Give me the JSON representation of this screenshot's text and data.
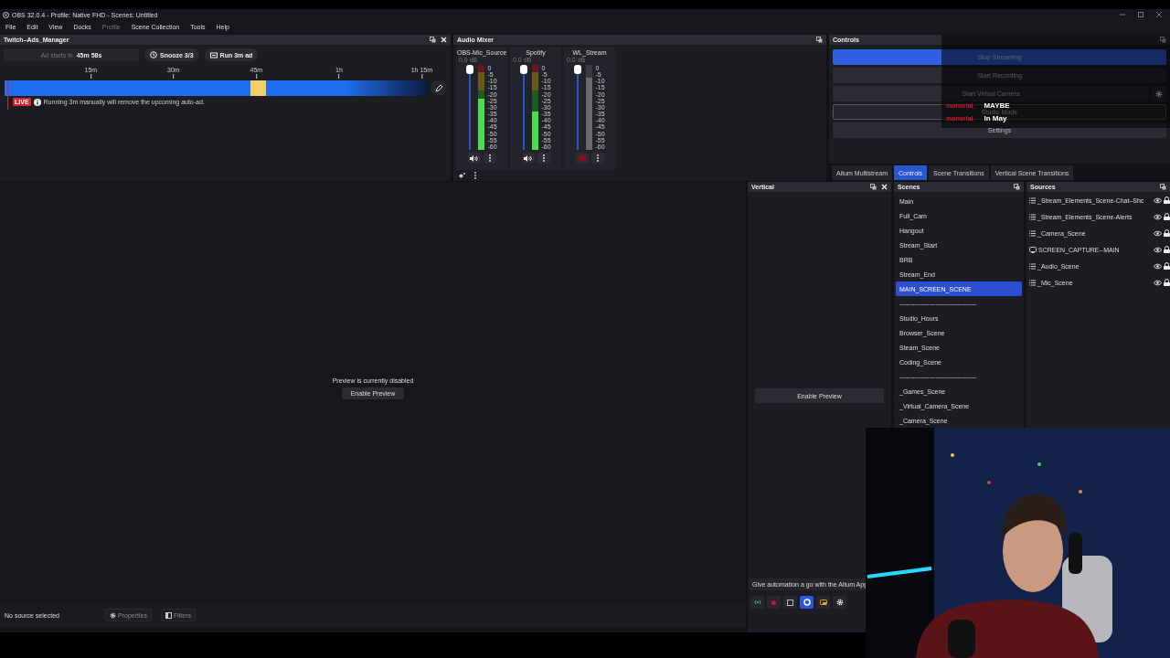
{
  "window": {
    "title": "OBS 32.0.4 - Profile: Native FHD - Scenes: Untitled"
  },
  "menu": [
    {
      "label": "File",
      "disabled": false
    },
    {
      "label": "Edit",
      "disabled": false
    },
    {
      "label": "View",
      "disabled": false
    },
    {
      "label": "Docks",
      "disabled": false
    },
    {
      "label": "Profile",
      "disabled": true
    },
    {
      "label": "Scene Collection",
      "disabled": false
    },
    {
      "label": "Tools",
      "disabled": false
    },
    {
      "label": "Help",
      "disabled": false
    }
  ],
  "ads_manager": {
    "title": "Twitch–Ads_Manager",
    "countdown_label": "Ad starts in",
    "countdown": "45m 58s",
    "snooze": "Snooze 3/3",
    "run_ad": "Run 3m ad",
    "ticks": [
      "15m",
      "30m",
      "45m",
      "1h",
      "1h 15m"
    ],
    "live_badge": "LIVE",
    "notice": "Running 3m manually will remove the upcoming auto-ad."
  },
  "audio_mixer": {
    "title": "Audio Mixer",
    "channels": [
      {
        "name": "OBS-Mic_Source",
        "reading": "0.0 dB",
        "muted": false,
        "slider": {
          "level": 1
        },
        "meter": {
          "level": 0.6
        },
        "scale": [
          "0",
          "-5",
          "-10",
          "-15",
          "-20",
          "-25",
          "-30",
          "-35",
          "-40",
          "-45",
          "-50",
          "-55",
          "-60"
        ]
      },
      {
        "name": "Spotify",
        "reading": "0.0 dB",
        "muted": false,
        "slider": {
          "level": 1
        },
        "meter": {
          "level": 0.45
        },
        "scale": [
          "0",
          "-5",
          "-10",
          "-15",
          "-20",
          "-25",
          "-30",
          "-35",
          "-40",
          "-45",
          "-50",
          "-55",
          "-60"
        ]
      },
      {
        "name": "WL_Stream",
        "reading": "0.0 dB",
        "muted": true,
        "slider": {
          "level": 1
        },
        "meter": {
          "level": 0.85
        },
        "scale": [
          "0",
          "-5",
          "-10",
          "-15",
          "-20",
          "-25",
          "-30",
          "-35",
          "-40",
          "-45",
          "-50",
          "-55",
          "-60"
        ]
      }
    ]
  },
  "controls": {
    "title": "Controls",
    "buttons": [
      {
        "label": "Stop Streaming",
        "kind": "active"
      },
      {
        "label": "Start Recording",
        "kind": "plain"
      },
      {
        "label": "Start Virtual Camera",
        "kind": "split"
      },
      {
        "label": "Studio Mode",
        "kind": "outlined"
      },
      {
        "label": "Settings",
        "kind": "plain"
      }
    ]
  },
  "chat_overlay": [
    {
      "user": "monorial_",
      "message": "MAYBE"
    },
    {
      "user": "monorial_",
      "message": "In May"
    }
  ],
  "dock_tabs": [
    {
      "label": "Aitum Multistream",
      "selected": false
    },
    {
      "label": "Controls",
      "selected": true
    },
    {
      "label": "Scene Transitions",
      "selected": false
    },
    {
      "label": "Vertical Scene Transitions",
      "selected": false
    }
  ],
  "preview": {
    "message": "Preview is currently disabled",
    "button": "Enable Preview"
  },
  "status": {
    "selection": "No source selected",
    "properties": "Properties",
    "filters": "Filters"
  },
  "vertical": {
    "title": "Vertical",
    "button": "Enable Preview",
    "promo": "Give automation a go with the Aitum App",
    "toolbar": [
      {
        "kind": "stream",
        "selected": false
      },
      {
        "kind": "record",
        "selected": false
      },
      {
        "kind": "square",
        "selected": false
      },
      {
        "kind": "replay",
        "selected": true
      },
      {
        "kind": "camera",
        "selected": false
      },
      {
        "kind": "settings",
        "selected": false
      }
    ]
  },
  "scenes": {
    "title": "Scenes",
    "items": [
      {
        "label": "Main",
        "selected": false
      },
      {
        "label": "Full_Cam",
        "selected": false
      },
      {
        "label": "Hangout",
        "selected": false
      },
      {
        "label": "Stream_Start",
        "selected": false
      },
      {
        "label": "BRB",
        "selected": false
      },
      {
        "label": "Stream_End",
        "selected": false
      },
      {
        "label": "MAIN_SCREEN_SCENE",
        "selected": true
      },
      {
        "label": "------------------------------------",
        "selected": false
      },
      {
        "label": "Studio_Hours",
        "selected": false
      },
      {
        "label": "Browser_Scene",
        "selected": false
      },
      {
        "label": "Steam_Scene",
        "selected": false
      },
      {
        "label": "Coding_Scene",
        "selected": false
      },
      {
        "label": "------------------------------------",
        "selected": false
      },
      {
        "label": "_Games_Scene",
        "selected": false
      },
      {
        "label": "_Virtual_Camera_Scene",
        "selected": false
      },
      {
        "label": "_Camera_Scene",
        "selected": false
      }
    ]
  },
  "sources": {
    "title": "Sources",
    "items": [
      {
        "label": "_Stream_Elements_Scene-Chat–Shc",
        "kind": "scene",
        "visible": true,
        "locked": true
      },
      {
        "label": "_Stream_Elements_Scene-Alerts",
        "kind": "scene",
        "visible": true,
        "locked": true
      },
      {
        "label": "_Camera_Scene",
        "kind": "scene",
        "visible": true,
        "locked": true
      },
      {
        "label": "SCREEN_CAPTURE--MAIN",
        "kind": "display",
        "visible": true,
        "locked": true
      },
      {
        "label": "_Audio_Scene",
        "kind": "scene",
        "visible": true,
        "locked": true
      },
      {
        "label": "_Mic_Scene",
        "kind": "scene",
        "visible": true,
        "locked": true
      }
    ]
  }
}
